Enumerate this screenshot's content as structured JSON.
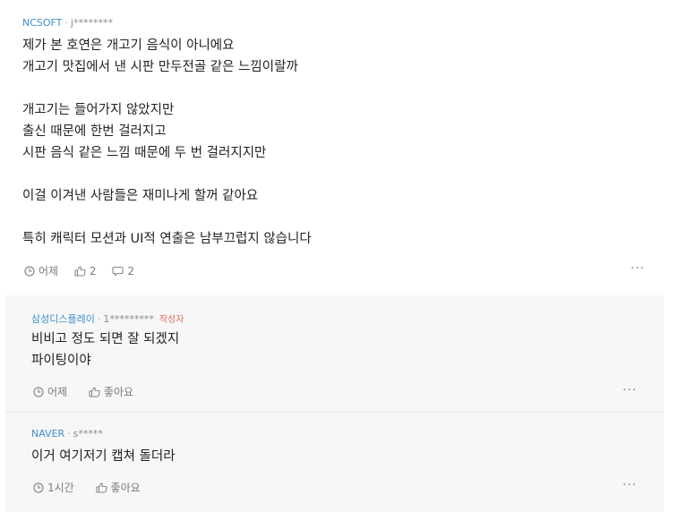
{
  "main_comment": {
    "company": "NCSOFT",
    "user": "j********",
    "lines": [
      "제가 본 호연은 개고기 음식이 아니에요",
      "개고기 맛집에서 낸 시판 만두전골 같은 느낌이랄까",
      "",
      "개고기는 들어가지 않았지만",
      "출신 때문에 한번 걸러지고",
      "시판 음식 같은 느낌 때문에 두 번 걸러지지만",
      "",
      "이걸 이겨낸 사람들은 재미나게 할꺼 같아요",
      "",
      "특히 캐릭터 모션과 UI적 연출은 남부끄럽지 않습니다"
    ],
    "time": "어제",
    "likes": "2",
    "replies": "2",
    "more": "···"
  },
  "replies": [
    {
      "company": "삼성디스플레이",
      "user": "1*********",
      "author_tag": "작성자",
      "lines": [
        "비비고 정도 되면 잘 되겠지",
        "파이팅이야"
      ],
      "time": "어제",
      "like_label": "좋아요",
      "more": "···"
    },
    {
      "company": "NAVER",
      "user": "s*****",
      "lines": [
        "이거 여기저기 캡쳐 돌더라"
      ],
      "time": "1시간",
      "like_label": "좋아요",
      "more": "···"
    }
  ],
  "colors": {
    "company": "#3f8fc9",
    "author_tag": "#e06a5a",
    "reply_bg": "#f7f7f7"
  }
}
